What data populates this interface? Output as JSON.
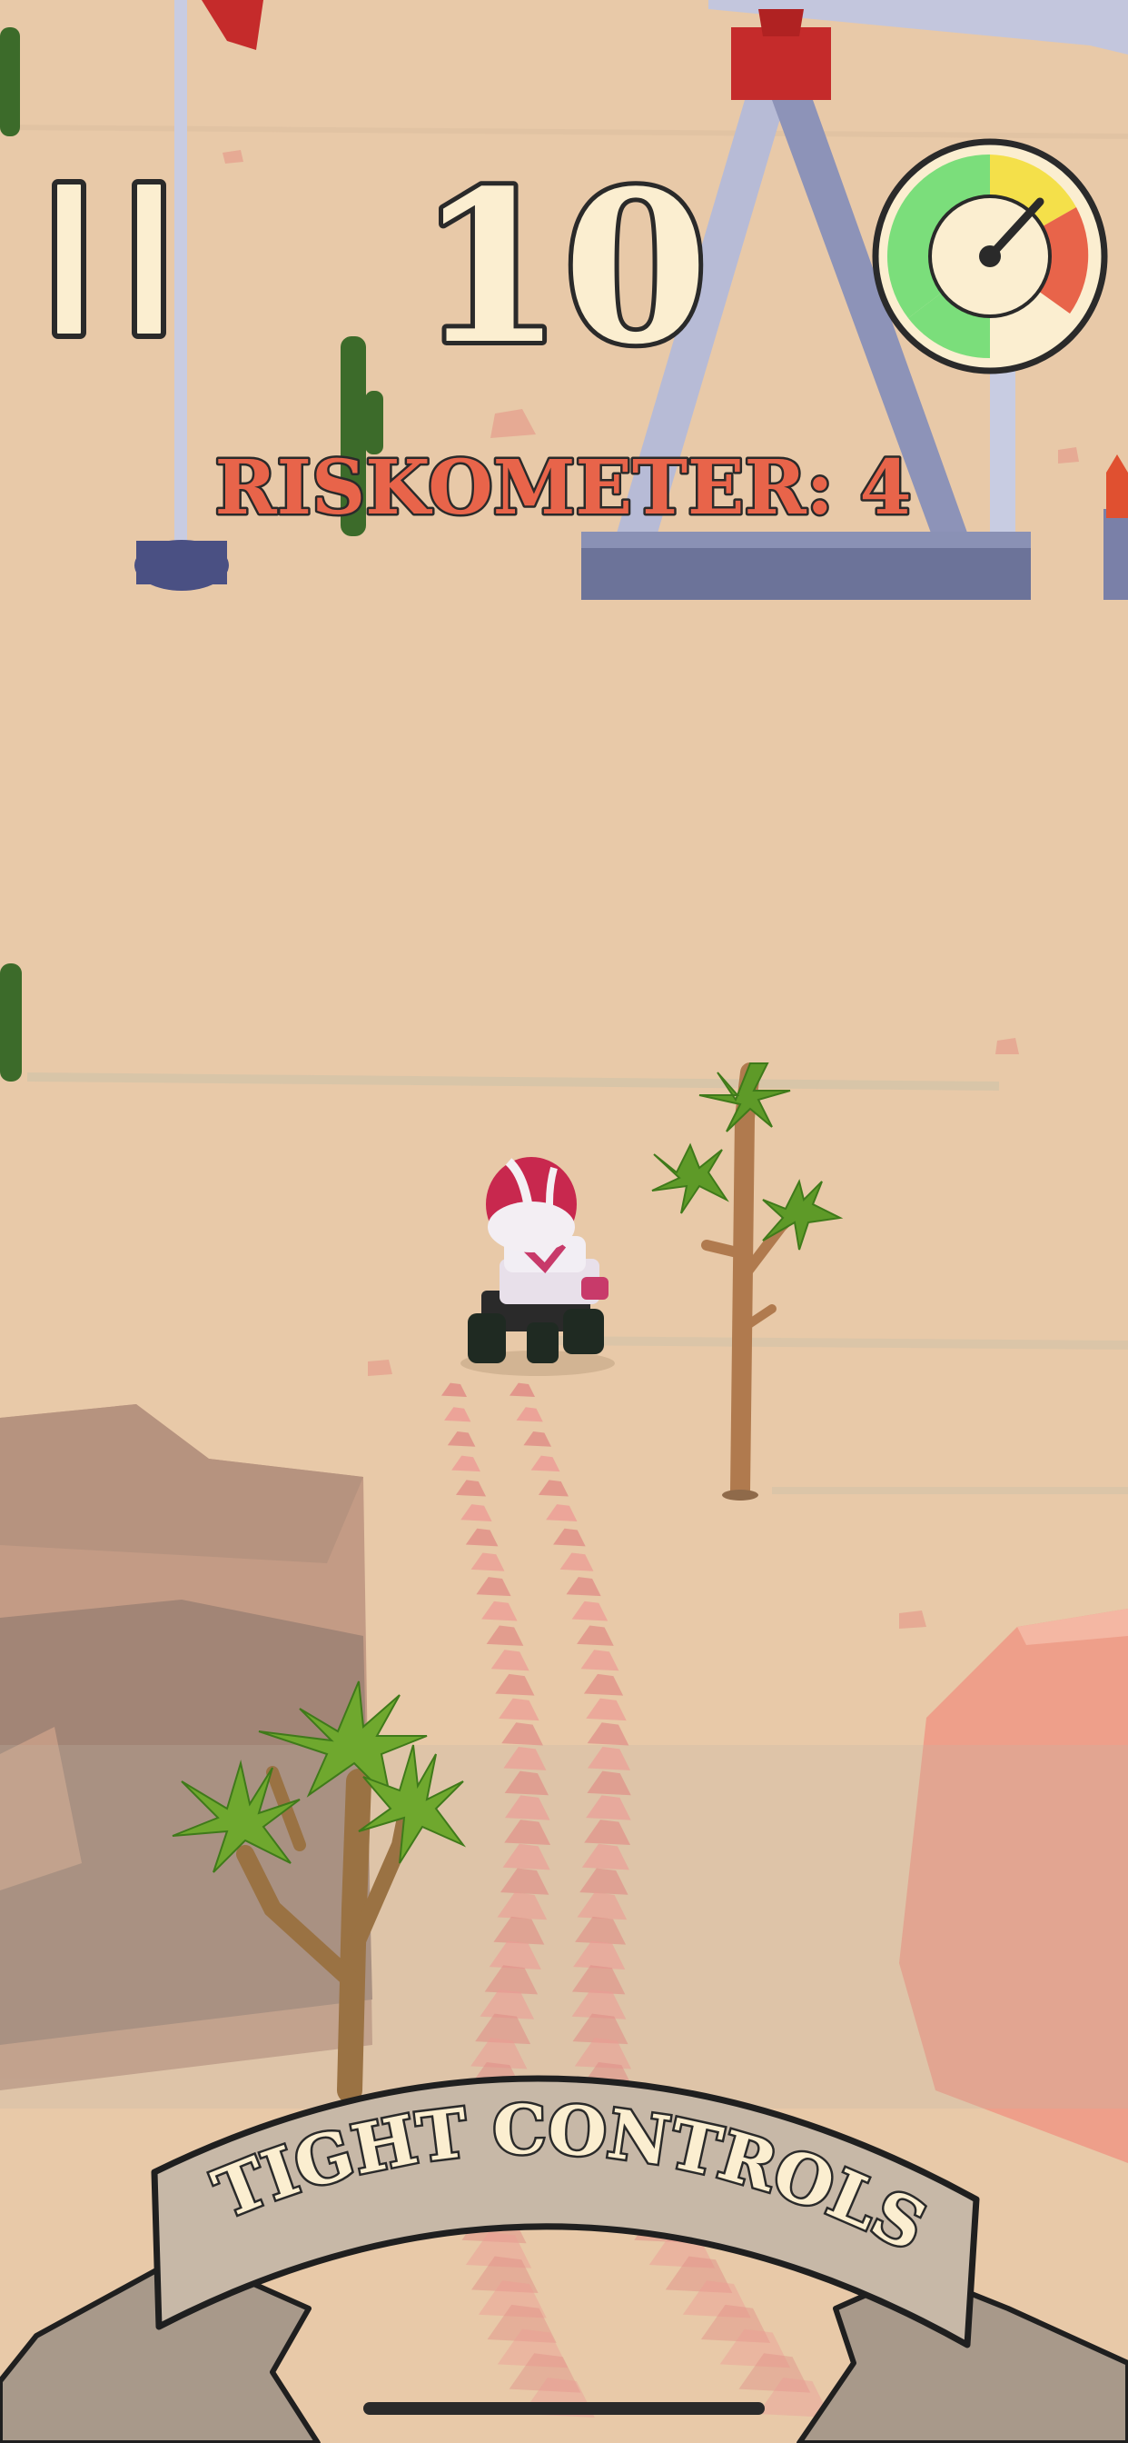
{
  "hud": {
    "score": "10",
    "risk_label": "RISKOMETER: 4",
    "risk_level": 4,
    "pause_icon": "pause-icon",
    "gauge_icon": "speedometer-gauge-icon"
  },
  "banner": {
    "text": "TIGHT CONTROLS"
  },
  "colors": {
    "sand": "#e8c9a8",
    "score_fill": "#fbeed0",
    "score_stroke": "#2a2a2a",
    "risk_fill": "#e8644a",
    "gauge_green": "#7bde7b",
    "gauge_yellow": "#f4e04a",
    "gauge_red": "#e8644a",
    "banner_fill": "#c7b8a7"
  }
}
